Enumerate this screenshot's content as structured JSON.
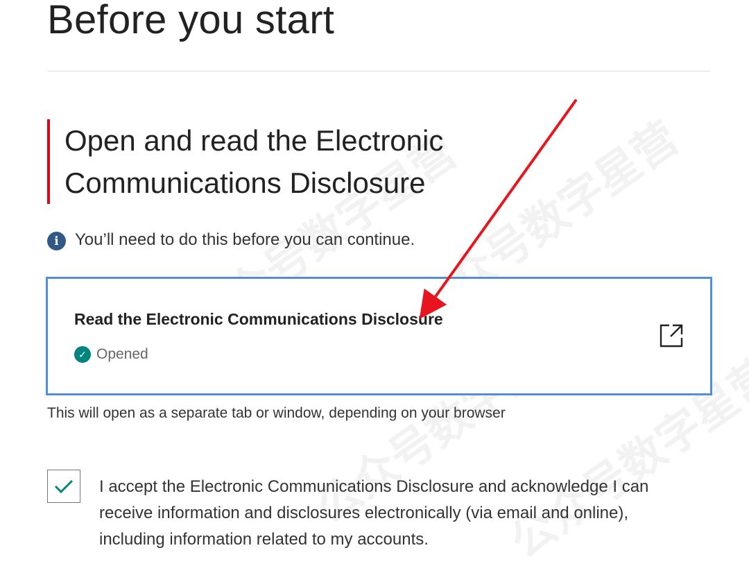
{
  "page": {
    "title": "Before you start"
  },
  "section": {
    "heading_line1": "Open and read the Electronic",
    "heading_line2": "Communications Disclosure"
  },
  "notice": {
    "icon": "info-icon",
    "text": "You’ll need to do this before you can continue."
  },
  "document_card": {
    "title": "Read the Electronic Communications Disclosure",
    "status_icon": "check-circle-icon",
    "status": "Opened",
    "action_icon": "external-link-icon"
  },
  "helper_text": "This will open as a separate tab or window, depending on your browser",
  "consent": {
    "checked": true,
    "text": "I accept the Electronic Communications Disclosure and acknowledge I can receive information and disclosures electronically (via email and online), including information related to my accounts."
  },
  "watermark": {
    "text": "公众号数字星营"
  },
  "colors": {
    "accent_red": "#db0011",
    "focus_blue": "#4f8fd8",
    "success_teal": "#00847f",
    "info_navy": "#305a85",
    "arrow_red": "#e8141e"
  }
}
